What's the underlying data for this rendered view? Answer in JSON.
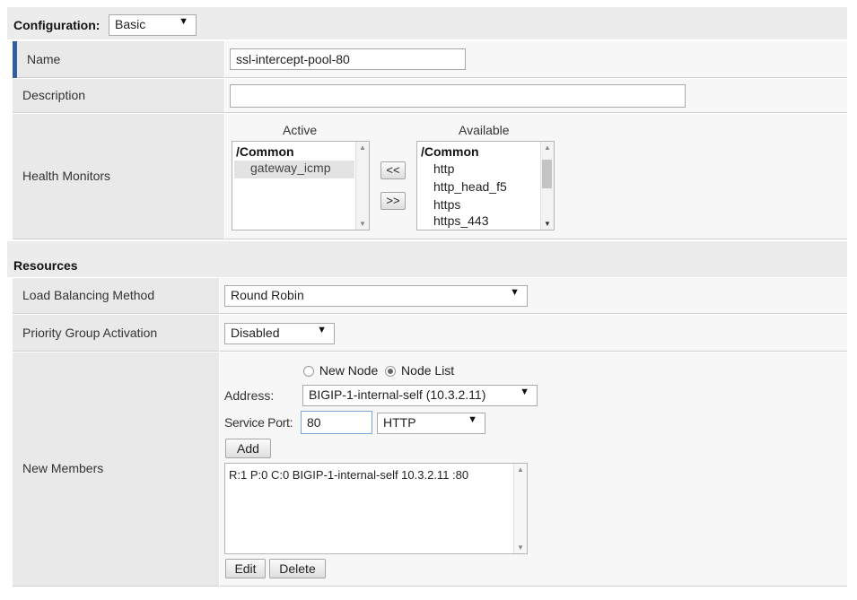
{
  "config": {
    "label": "Configuration:",
    "mode": "Basic"
  },
  "fields": {
    "name": {
      "label": "Name",
      "value": "ssl-intercept-pool-80"
    },
    "description": {
      "label": "Description",
      "value": ""
    },
    "health_monitors": {
      "label": "Health Monitors",
      "active_header": "Active",
      "available_header": "Available",
      "active_group": "/Common",
      "active_items": [
        "gateway_icmp"
      ],
      "available_group": "/Common",
      "available_items": [
        "http",
        "http_head_f5",
        "https",
        "https_443"
      ],
      "move_left_label": "<<",
      "move_right_label": ">>"
    }
  },
  "resources": {
    "title": "Resources",
    "lb_method": {
      "label": "Load Balancing Method",
      "value": "Round Robin"
    },
    "priority_group": {
      "label": "Priority Group Activation",
      "value": "Disabled"
    },
    "new_members": {
      "label": "New Members",
      "option_new_node": "New Node",
      "option_node_list": "Node List",
      "address_label": "Address:",
      "address_value": "BIGIP-1-internal-self (10.3.2.11)",
      "service_port_label": "Service Port:",
      "service_port_value": "80",
      "service_value": "HTTP",
      "add_label": "Add",
      "members": [
        "R:1 P:0 C:0 BIGIP-1-internal-self 10.3.2.11 :80"
      ],
      "edit_label": "Edit",
      "delete_label": "Delete"
    }
  },
  "colors": {
    "accent": "#2f5f9e"
  }
}
